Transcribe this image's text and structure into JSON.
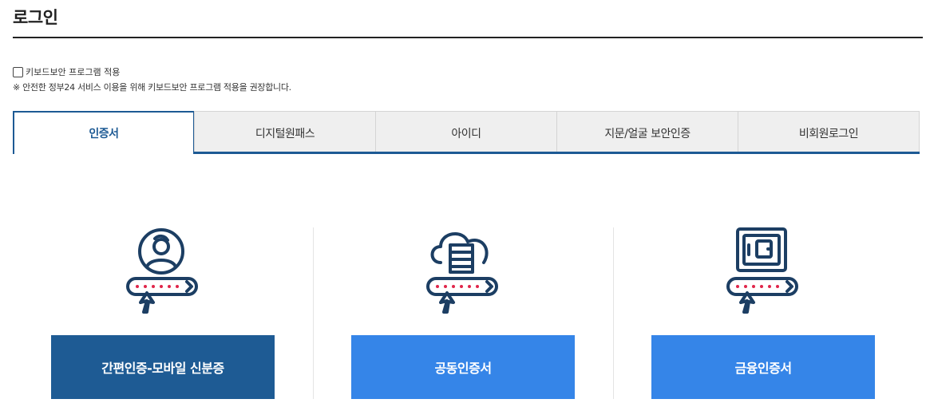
{
  "page": {
    "title": "로그인"
  },
  "keyboard_security": {
    "checkbox_label": "키보드보안 프로그램 적용",
    "checked": false,
    "notice": "※ 안전한 정부24 서비스 이용을 위해 키보드보안 프로그램 적용을 권장합니다."
  },
  "tabs": [
    {
      "label": "인증서",
      "active": true
    },
    {
      "label": "디지털원패스",
      "active": false
    },
    {
      "label": "아이디",
      "active": false
    },
    {
      "label": "지문/얼굴 보안인증",
      "active": false
    },
    {
      "label": "비회원로그인",
      "active": false
    }
  ],
  "login_options": [
    {
      "icon": "user-password-icon",
      "button_label": "간편인증-모바일 신분증"
    },
    {
      "icon": "cloud-server-password-icon",
      "button_label": "공동인증서"
    },
    {
      "icon": "safe-password-icon",
      "button_label": "금융인증서"
    }
  ],
  "colors": {
    "primary_dark": "#1e5b94",
    "primary_light": "#3585e8",
    "icon_stroke": "#1c3e63",
    "password_dots": "#e0264a"
  }
}
